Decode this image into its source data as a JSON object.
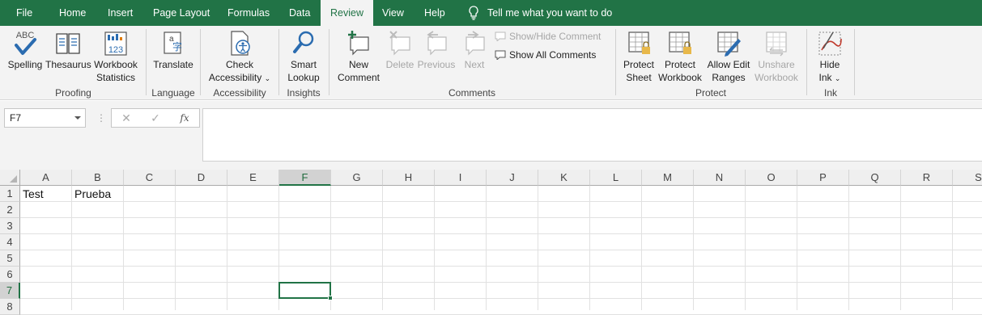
{
  "menu": {
    "tabs": [
      {
        "label": "File"
      },
      {
        "label": "Home"
      },
      {
        "label": "Insert"
      },
      {
        "label": "Page Layout"
      },
      {
        "label": "Formulas"
      },
      {
        "label": "Data"
      },
      {
        "label": "Review"
      },
      {
        "label": "View"
      },
      {
        "label": "Help"
      }
    ],
    "active_tab": "Review",
    "tell_me": "Tell me what you want to do"
  },
  "ribbon": {
    "proofing": {
      "label": "Proofing",
      "spelling": "Spelling",
      "spelling_icon_text": "ABC",
      "thesaurus": "Thesaurus",
      "workbook_stats_1": "Workbook",
      "workbook_stats_2": "Statistics",
      "workbook_stats_icon_text": "123"
    },
    "language": {
      "label": "Language",
      "translate": "Translate"
    },
    "accessibility": {
      "label": "Accessibility",
      "check_1": "Check",
      "check_2": "Accessibility"
    },
    "insights": {
      "label": "Insights",
      "smart_1": "Smart",
      "smart_2": "Lookup"
    },
    "comments": {
      "label": "Comments",
      "new_1": "New",
      "new_2": "Comment",
      "delete": "Delete",
      "previous": "Previous",
      "next": "Next",
      "show_hide": "Show/Hide Comment",
      "show_all": "Show All Comments"
    },
    "protect": {
      "label": "Protect",
      "sheet_1": "Protect",
      "sheet_2": "Sheet",
      "workbook_1": "Protect",
      "workbook_2": "Workbook",
      "ranges_1": "Allow Edit",
      "ranges_2": "Ranges",
      "unshare_1": "Unshare",
      "unshare_2": "Workbook"
    },
    "ink": {
      "label": "Ink",
      "hide_1": "Hide",
      "hide_2": "Ink"
    }
  },
  "formula_bar": {
    "name_box": "F7",
    "cancel_symbol": "✕",
    "enter_symbol": "✓",
    "fx_symbol": "fx",
    "content": ""
  },
  "sheet": {
    "columns": [
      "A",
      "B",
      "C",
      "D",
      "E",
      "F",
      "G",
      "H",
      "I",
      "J",
      "K",
      "L",
      "M",
      "N",
      "O",
      "P",
      "Q",
      "R",
      "S"
    ],
    "rows": [
      "1",
      "2",
      "3",
      "4",
      "5",
      "6",
      "7",
      "8"
    ],
    "selected_cell": "F7",
    "cells": {
      "A1": "Test",
      "B1": "Prueba"
    }
  },
  "colors": {
    "accent": "#217346",
    "ribbon_bg": "#f3f3f3"
  }
}
